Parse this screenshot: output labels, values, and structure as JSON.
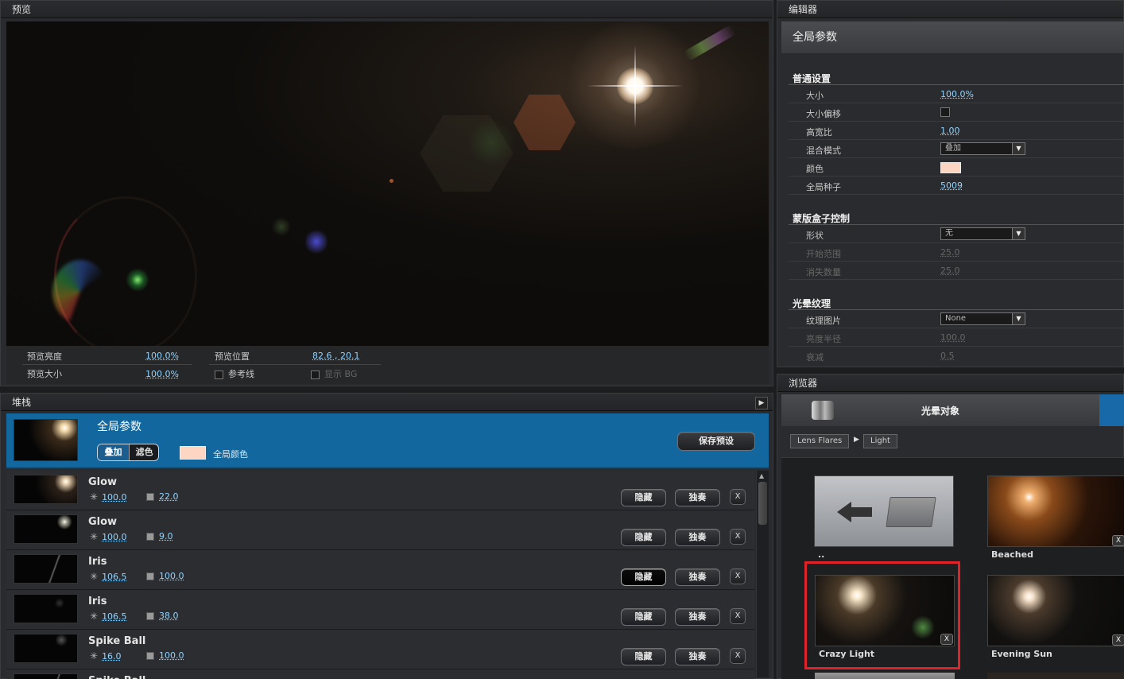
{
  "preview": {
    "title": "预览",
    "brightness_label": "预览亮度",
    "brightness_value": "100.0%",
    "size_label": "预览大小",
    "size_value": "100.0%",
    "position_label": "预览位置",
    "position_value": "82.6 , 20.1",
    "guides_label": "参考线",
    "show_bg_label": "显示 BG"
  },
  "stack": {
    "title": "堆栈",
    "global": {
      "name": "全局参数",
      "mode_add": "叠加",
      "mode_screen": "滤色",
      "color_label": "全局颜色",
      "save_preset": "保存预设"
    },
    "hide_label": "隐藏",
    "solo_label": "独奏",
    "close_label": "X",
    "layers": [
      {
        "name": "Glow",
        "brightness": "100.0",
        "size": "22.0"
      },
      {
        "name": "Glow",
        "brightness": "100.0",
        "size": "9.0"
      },
      {
        "name": "Iris",
        "brightness": "106.5",
        "size": "100.0"
      },
      {
        "name": "Iris",
        "brightness": "106.5",
        "size": "38.0"
      },
      {
        "name": "Spike Ball",
        "brightness": "16.0",
        "size": "100.0"
      },
      {
        "name": "Spike Ball",
        "brightness": "",
        "size": ""
      }
    ]
  },
  "editor": {
    "title": "编辑器",
    "header": "全局参数",
    "general": {
      "title": "普通设置",
      "size_label": "大小",
      "size_value": "100.0%",
      "offset_label": "大小偏移",
      "aspect_label": "高宽比",
      "aspect_value": "1.00",
      "blend_label": "混合模式",
      "blend_value": "叠加",
      "color_label": "颜色",
      "seed_label": "全局种子",
      "seed_value": "5009"
    },
    "mask": {
      "title": "蒙版盒子控制",
      "shape_label": "形状",
      "shape_value": "无",
      "start_label": "开始范围",
      "start_value": "25.0",
      "fade_label": "消失数量",
      "fade_value": "25.0"
    },
    "texture": {
      "title": "光晕纹理",
      "image_label": "纹理图片",
      "image_value": "None",
      "radius_label": "亮度半径",
      "radius_value": "100.0",
      "decay_label": "衰减",
      "decay_value": "0.5"
    }
  },
  "browser": {
    "title": "浏览器",
    "header": "光晕对象",
    "breadcrumb": [
      "Lens Flares",
      "Light"
    ],
    "tiles": [
      {
        "label": ".."
      },
      {
        "label": "Beached"
      },
      {
        "label": "Crazy Light"
      },
      {
        "label": "Evening Sun"
      }
    ],
    "tile_close": "X"
  },
  "colors": {
    "accent_blue": "#12689e",
    "global_color": "#fcd6c2",
    "highlight": "#e0232a"
  }
}
